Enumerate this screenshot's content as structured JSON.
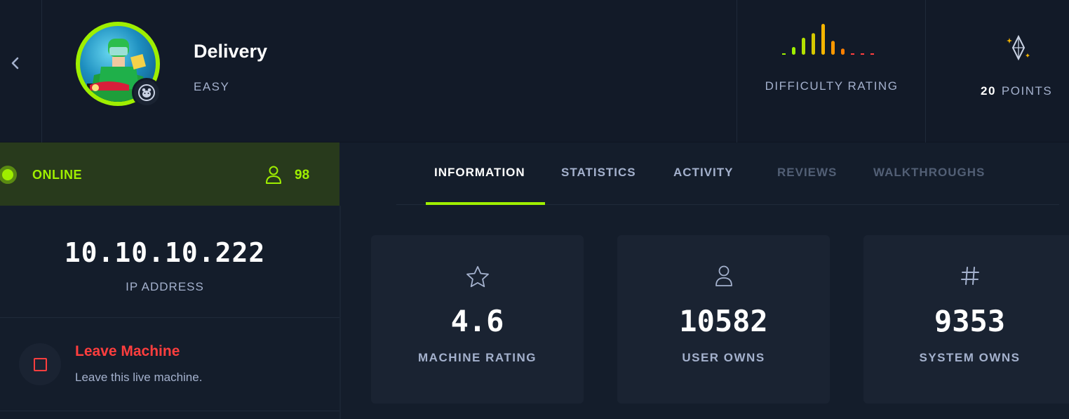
{
  "machine": {
    "name": "Delivery",
    "difficulty": "EASY",
    "difficulty_rating_label": "DIFFICULTY RATING",
    "difficulty_bar_levels": [
      0.1,
      0.25,
      0.55,
      0.7,
      1.0,
      0.45,
      0.2,
      0.08,
      0.08,
      0.08
    ],
    "points_value": "20",
    "points_label": "POINTS"
  },
  "status": {
    "state": "ONLINE",
    "players": "98",
    "color": "#9fef00"
  },
  "connection": {
    "ip": "10.10.10.222",
    "ip_label": "IP ADDRESS"
  },
  "leave": {
    "title": "Leave Machine",
    "description": "Leave this live machine.",
    "color": "#ff3e3e"
  },
  "tabs": [
    {
      "label": "INFORMATION",
      "state": "active"
    },
    {
      "label": "STATISTICS",
      "state": "enabled"
    },
    {
      "label": "ACTIVITY",
      "state": "enabled"
    },
    {
      "label": "REVIEWS",
      "state": "disabled"
    },
    {
      "label": "WALKTHROUGHS",
      "state": "disabled"
    }
  ],
  "stats": [
    {
      "icon": "star-icon",
      "value": "4.6",
      "label": "MACHINE RATING"
    },
    {
      "icon": "user-icon",
      "value": "10582",
      "label": "USER OWNS"
    },
    {
      "icon": "hash-icon",
      "value": "9353",
      "label": "SYSTEM OWNS"
    }
  ],
  "colors": {
    "background": "#141d2b",
    "card": "#1a2332",
    "accent": "#9fef00",
    "muted_text": "#a4b1cd"
  }
}
